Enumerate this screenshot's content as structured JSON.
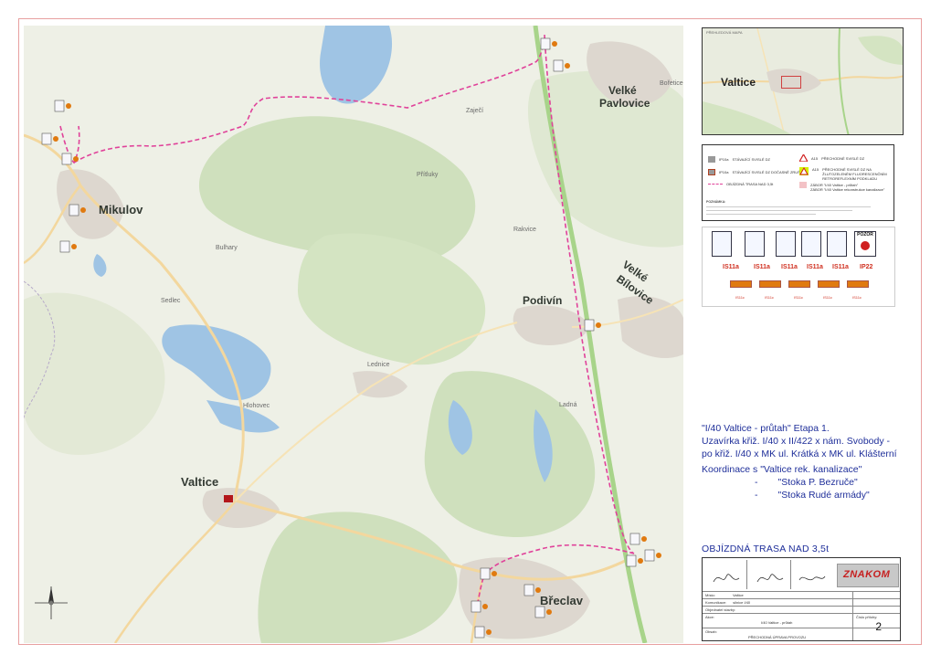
{
  "map": {
    "towns": [
      {
        "name": "Mikulov",
        "cls": "big"
      },
      {
        "name": "Valtice",
        "cls": "big"
      },
      {
        "name": "Břeclav",
        "cls": "big"
      },
      {
        "name": "Podivín",
        "cls": ""
      },
      {
        "name": "Velké",
        "cls": ""
      },
      {
        "name": "Pavlovice",
        "cls": ""
      },
      {
        "name": "Velké",
        "cls": ""
      },
      {
        "name": "Bílovice",
        "cls": ""
      }
    ],
    "places": [
      "Lednice",
      "Hlohovec",
      "Rakvice",
      "Ladná",
      "Zaječí",
      "Bořetice",
      "Sedlec",
      "Bulhary",
      "Přítluky"
    ],
    "route_color": "#e0429a"
  },
  "inset": {
    "title": "PŘEHLEDOVÁ MAPA",
    "town": "Valtice"
  },
  "legend": {
    "rows_left": [
      "STÁVAJÍCÍ SVISLÉ DZ",
      "STÁVAJÍCÍ SVISLÉ DZ DOČASNĚ ZRUŠENÉ",
      "OBJÍZDNÁ TRASA NAD 3,5t"
    ],
    "codes_left": [
      "IP10a",
      "IP10a"
    ],
    "rows_right": [
      "PŘECHODNÉ SVISLÉ DZ",
      "PŘECHODNÉ SVISLÉ DZ NA ŽLUTOZELENÉM FLUORESCENČNÍM RETROREFLEXNÍM PODKLADU",
      "ZÁBOR \"I/40 Valtice - průtah\"",
      "ZÁBOR \"I/40 Valtice rekonstrukce kanalizace\""
    ],
    "codes_right": [
      "A15",
      "A15"
    ],
    "note_title": "POZNÁMKA:"
  },
  "signs": {
    "codes": [
      "IS11a",
      "IS11a",
      "IS11a",
      "IS11a",
      "IS11a",
      "IP22"
    ],
    "pozor": "POZOR",
    "arrows": [
      "IS11c",
      "IS11c",
      "IS11c",
      "IS11c",
      "IS11c"
    ]
  },
  "description": {
    "line1": "\"I/40 Valtice - průtah\" Etapa 1.",
    "line2": "Uzavírka křiž. I/40 x II/422 x nám. Svobody -",
    "line3": "po křiž. I/40 x MK ul. Krátká x MK ul. Klášterní",
    "line4": "Koordinace s \"Valtice rek. kanalizace\"",
    "line5_dash": "-",
    "line5": "\"Stoka P. Bezruče\"",
    "line6_dash": "-",
    "line6": "\"Stoka Rudé armády\""
  },
  "detour_title": "OBJÍZDNÁ TRASA NAD 3,5t",
  "title_block": {
    "logo": "ZNAKOM",
    "misto_label": "Místo:",
    "misto": "Valtice",
    "komunikace_label": "Komunikace:",
    "komunikace": "silnice I/40",
    "stavba_label": "Objednatel stavby:",
    "akce_label": "Akce:",
    "akce": "I/40 Valtice - průtah",
    "obsah_label": "Obsah:",
    "obsah": "PŘECHODNÁ ÚPRAVA PROVOZU",
    "cislo_label": "Číslo přílohy:",
    "cislo": "2"
  }
}
